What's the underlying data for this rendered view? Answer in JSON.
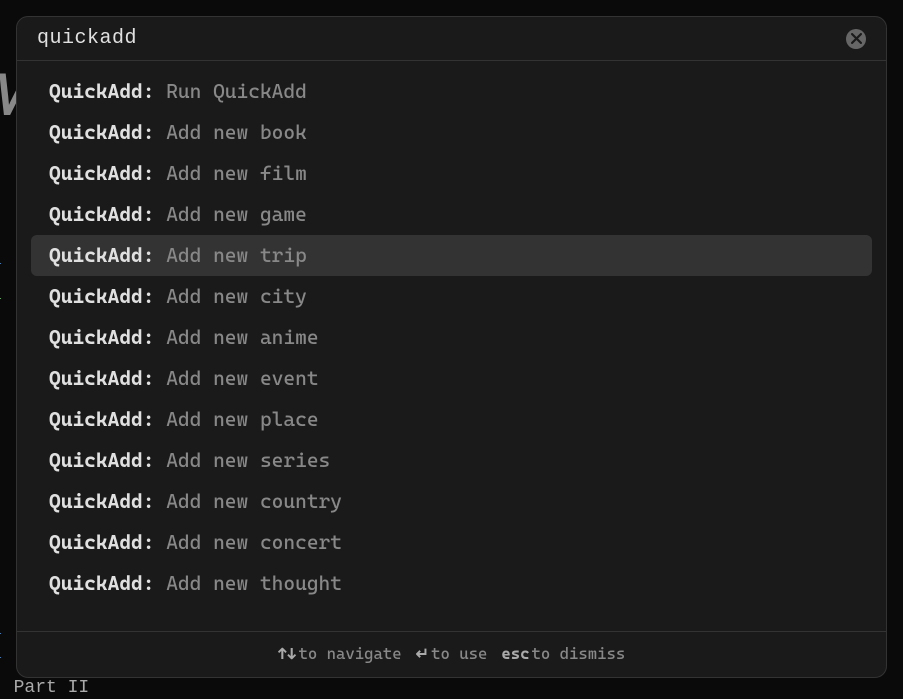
{
  "search": {
    "value": "quickadd"
  },
  "results": [
    {
      "prefix": "QuickAdd:",
      "action": "Run QuickAdd",
      "selected": false
    },
    {
      "prefix": "QuickAdd:",
      "action": "Add new book",
      "selected": false
    },
    {
      "prefix": "QuickAdd:",
      "action": "Add new film",
      "selected": false
    },
    {
      "prefix": "QuickAdd:",
      "action": "Add new game",
      "selected": false
    },
    {
      "prefix": "QuickAdd:",
      "action": "Add new trip",
      "selected": true
    },
    {
      "prefix": "QuickAdd:",
      "action": "Add new city",
      "selected": false
    },
    {
      "prefix": "QuickAdd:",
      "action": "Add new anime",
      "selected": false
    },
    {
      "prefix": "QuickAdd:",
      "action": "Add new event",
      "selected": false
    },
    {
      "prefix": "QuickAdd:",
      "action": "Add new place",
      "selected": false
    },
    {
      "prefix": "QuickAdd:",
      "action": "Add new series",
      "selected": false
    },
    {
      "prefix": "QuickAdd:",
      "action": "Add new country",
      "selected": false
    },
    {
      "prefix": "QuickAdd:",
      "action": "Add new concert",
      "selected": false
    },
    {
      "prefix": "QuickAdd:",
      "action": "Add new thought",
      "selected": false
    }
  ],
  "hints": {
    "navigate_key": "↑↓",
    "navigate_text": "to navigate",
    "use_key": "↵",
    "use_text": "to use",
    "dismiss_key": "esc",
    "dismiss_text": "to dismiss"
  },
  "background": {
    "letter": "M",
    "line1": "c",
    "line2": "S",
    "line3": "i",
    "line4": "h",
    "line5": ": Part II"
  }
}
